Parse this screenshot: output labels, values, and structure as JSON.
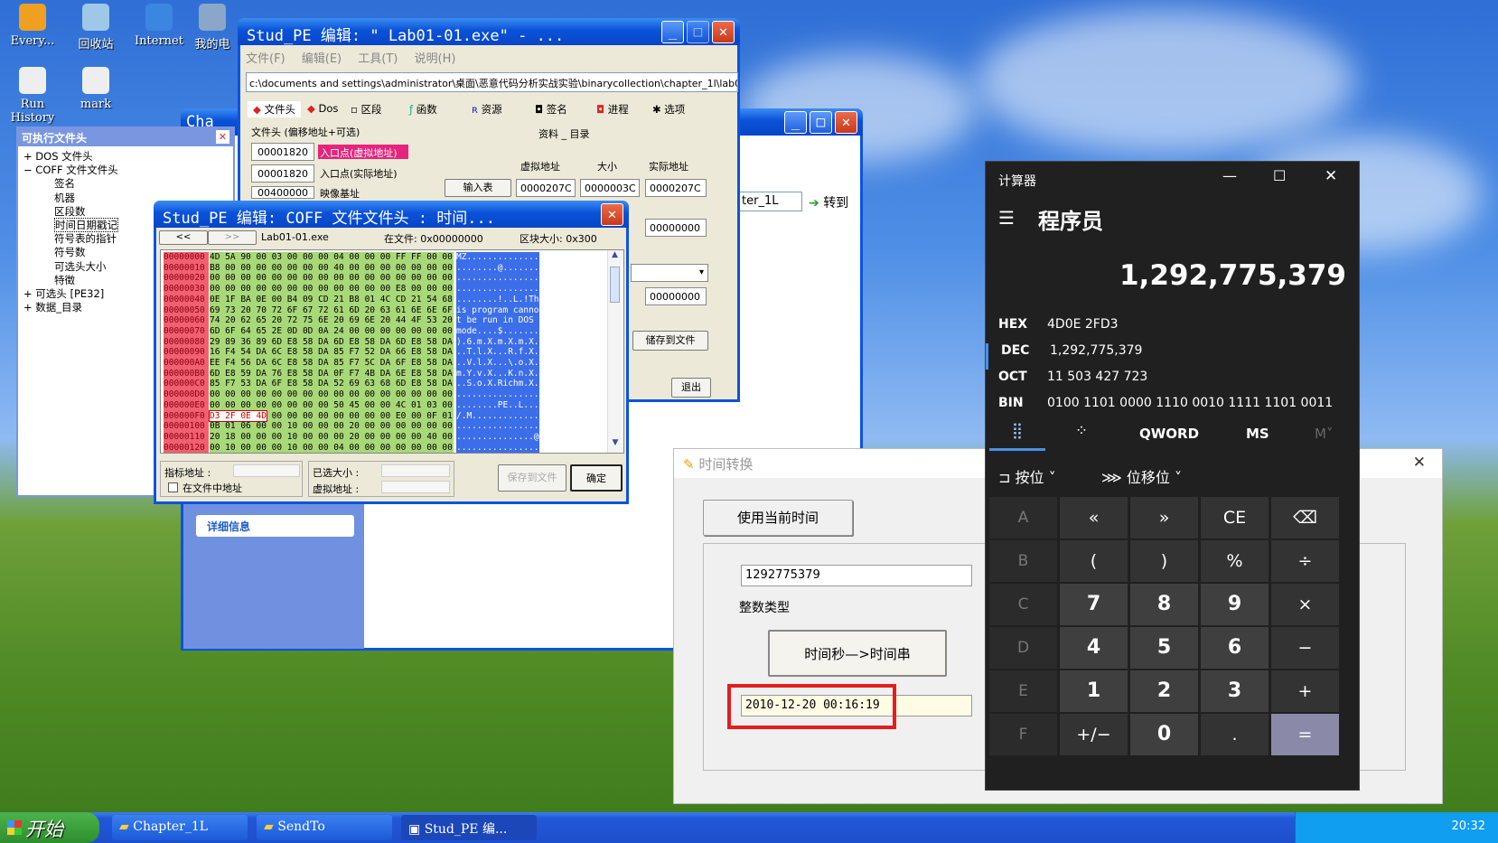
{
  "desktop": {
    "icons": [
      "Every...",
      "回收站",
      "Internet",
      "我的电",
      "Run History",
      "mark"
    ]
  },
  "pe": {
    "title": "Stud_PE 编辑: \"    Lab01-01.exe\" - ...",
    "menu": [
      "文件(F)",
      "编辑(E)",
      "工具(T)",
      "说明(H)"
    ],
    "path": "c:\\documents and settings\\administrator\\桌面\\恶意代码分析实战实验\\binarycollection\\chapter_1l\\lab01-0",
    "tabs": [
      "文件头",
      "Dos",
      "区段",
      "函数",
      "资源",
      "签名",
      "进程",
      "选项"
    ],
    "header_label": "文件头 (偏移地址+可选)",
    "dir_label": "资料 _ 目录",
    "col_heads": [
      "虚拟地址",
      "大小",
      "实际地址"
    ],
    "ep1": "00001820",
    "ep1_label": "入口点(虚拟地址)",
    "ep2": "00001820",
    "ep2_label": "入口点(实际地址)",
    "ib": "00400000",
    "ib_label": "映像基址",
    "import_btn": "输入表",
    "imp": [
      "0000207C",
      "0000003C",
      "0000207C"
    ],
    "v2": "00000000",
    "v3": "00000000",
    "save": "储存到文件",
    "exit": "退出"
  },
  "side": {
    "title": "可执行文件头",
    "items": [
      "DOS 文件头",
      "COFF 文件文件头",
      "签名",
      "机器",
      "区段数",
      "时间日期戳记",
      "符号表的指针",
      "符号数",
      "可选头大小",
      "特徵",
      "可选头 [PE32]",
      "数据_目录"
    ],
    "tab": "Cha"
  },
  "explorer": {
    "address": "ter_1L",
    "go": "转到",
    "details": "详细信息"
  },
  "coff": {
    "title": "Stud_PE 编辑:   COFF 文件文件头  : 时间...",
    "nav": [
      "<<",
      ">>"
    ],
    "file": "Lab01-01.exe",
    "in_file": "在文件: 0x00000000",
    "block": "区块大小: 0x300",
    "offsets": [
      "00000000",
      "00000010",
      "00000020",
      "00000030",
      "00000040",
      "00000050",
      "00000060",
      "00000070",
      "00000080",
      "00000090",
      "000000A0",
      "000000B0",
      "000000C0",
      "000000D0",
      "000000E0",
      "000000F0",
      "00000100",
      "00000110",
      "00000120"
    ],
    "hex": [
      "4D 5A 90 00 03 00 00 00 04 00 00 00 FF FF 00 00",
      "B8 00 00 00 00 00 00 00 40 00 00 00 00 00 00 00",
      "00 00 00 00 00 00 00 00 00 00 00 00 00 00 00 00",
      "00 00 00 00 00 00 00 00 00 00 00 00 E8 00 00 00",
      "0E 1F BA 0E 00 B4 09 CD 21 B8 01 4C CD 21 54 68",
      "69 73 20 70 72 6F 67 72 61 6D 20 63 61 6E 6E 6F",
      "74 20 62 65 20 72 75 6E 20 69 6E 20 44 4F 53 20",
      "6D 6F 64 65 2E 0D 0D 0A 24 00 00 00 00 00 00 00",
      "29 89 36 89 6D E8 58 DA 6D E8 58 DA 6D E8 58 DA",
      "16 F4 54 DA 6C E8 58 DA 85 F7 52 DA 66 E8 58 DA",
      "EE F4 56 DA 6C E8 58 DA 85 F7 5C DA 6F E8 58 DA",
      "6D E8 59 DA 76 E8 58 DA 0F F7 4B DA 6E E8 58 DA",
      "85 F7 53 DA 6F E8 58 DA 52 69 63 68 6D E8 58 DA",
      "00 00 00 00 00 00 00 00 00 00 00 00 00 00 00 00",
      "00 00 00 00 00 00 00 00 50 45 00 00 4C 01 03 00",
      "D3 2F 0E 4D 00 00 00 00 00 00 00 00 E0 00 0F 01",
      "0B 01 06 00 00 10 00 00 00 20 00 00 00 00 00 00",
      "20 18 00 00 00 10 00 00 00 20 00 00 00 00 40 00",
      "00 10 00 00 00 10 00 00 04 00 00 00 00 00 00 00"
    ],
    "ascii": [
      "MZ..............",
      "........@.......",
      "................",
      "................",
      "........!..L.!Th",
      "is program canno",
      "t be run in DOS ",
      "mode....$.......",
      ").6.m.X.m.X.m.X.",
      "..T.l.X...R.f.X.",
      "..V.l.X...\\.o.X.",
      "m.Y.v.X...K.n.X.",
      "..S.o.X.Richm.X.",
      "................",
      "........PE..L...",
      "/.M.............",
      "................",
      "...............@.",
      "................"
    ],
    "ptr": "指标地址 :",
    "chk": "在文件中地址",
    "sel": "已选大小 :",
    "vaddr": "虚拟地址 :",
    "save": "保存到文件",
    "ok": "确定"
  },
  "tc": {
    "title": "时间转换",
    "use_now": "使用当前时间",
    "input": "1292775379",
    "type": "整数类型",
    "convert": "时间秒—>时间串",
    "result": "2010-12-20 00:16:19"
  },
  "calc": {
    "title": "计算器",
    "mode": "程序员",
    "value": "1,292,775,379",
    "radix": [
      {
        "k": "HEX",
        "v": "4D0E 2FD3"
      },
      {
        "k": "DEC",
        "v": "1,292,775,379"
      },
      {
        "k": "OCT",
        "v": "11 503 427 723"
      },
      {
        "k": "BIN",
        "v": "0100 1101 0000 1110 0010 1111 1101 0011"
      }
    ],
    "word": "QWORD",
    "ms": "MS",
    "mplus": "M˅",
    "bitwise": "按位",
    "shift": "位移位",
    "keys": [
      [
        "A",
        "«",
        "»",
        "CE",
        "⌫"
      ],
      [
        "B",
        "(",
        ")",
        "%",
        "÷"
      ],
      [
        "C",
        "7",
        "8",
        "9",
        "×"
      ],
      [
        "D",
        "4",
        "5",
        "6",
        "−"
      ],
      [
        "E",
        "1",
        "2",
        "3",
        "+"
      ],
      [
        "F",
        "+/−",
        "0",
        ".",
        "="
      ]
    ]
  },
  "taskbar": {
    "start": "开始",
    "items": [
      "Chapter_1L",
      "SendTo",
      "Stud_PE 编..."
    ],
    "time": "20:32"
  }
}
